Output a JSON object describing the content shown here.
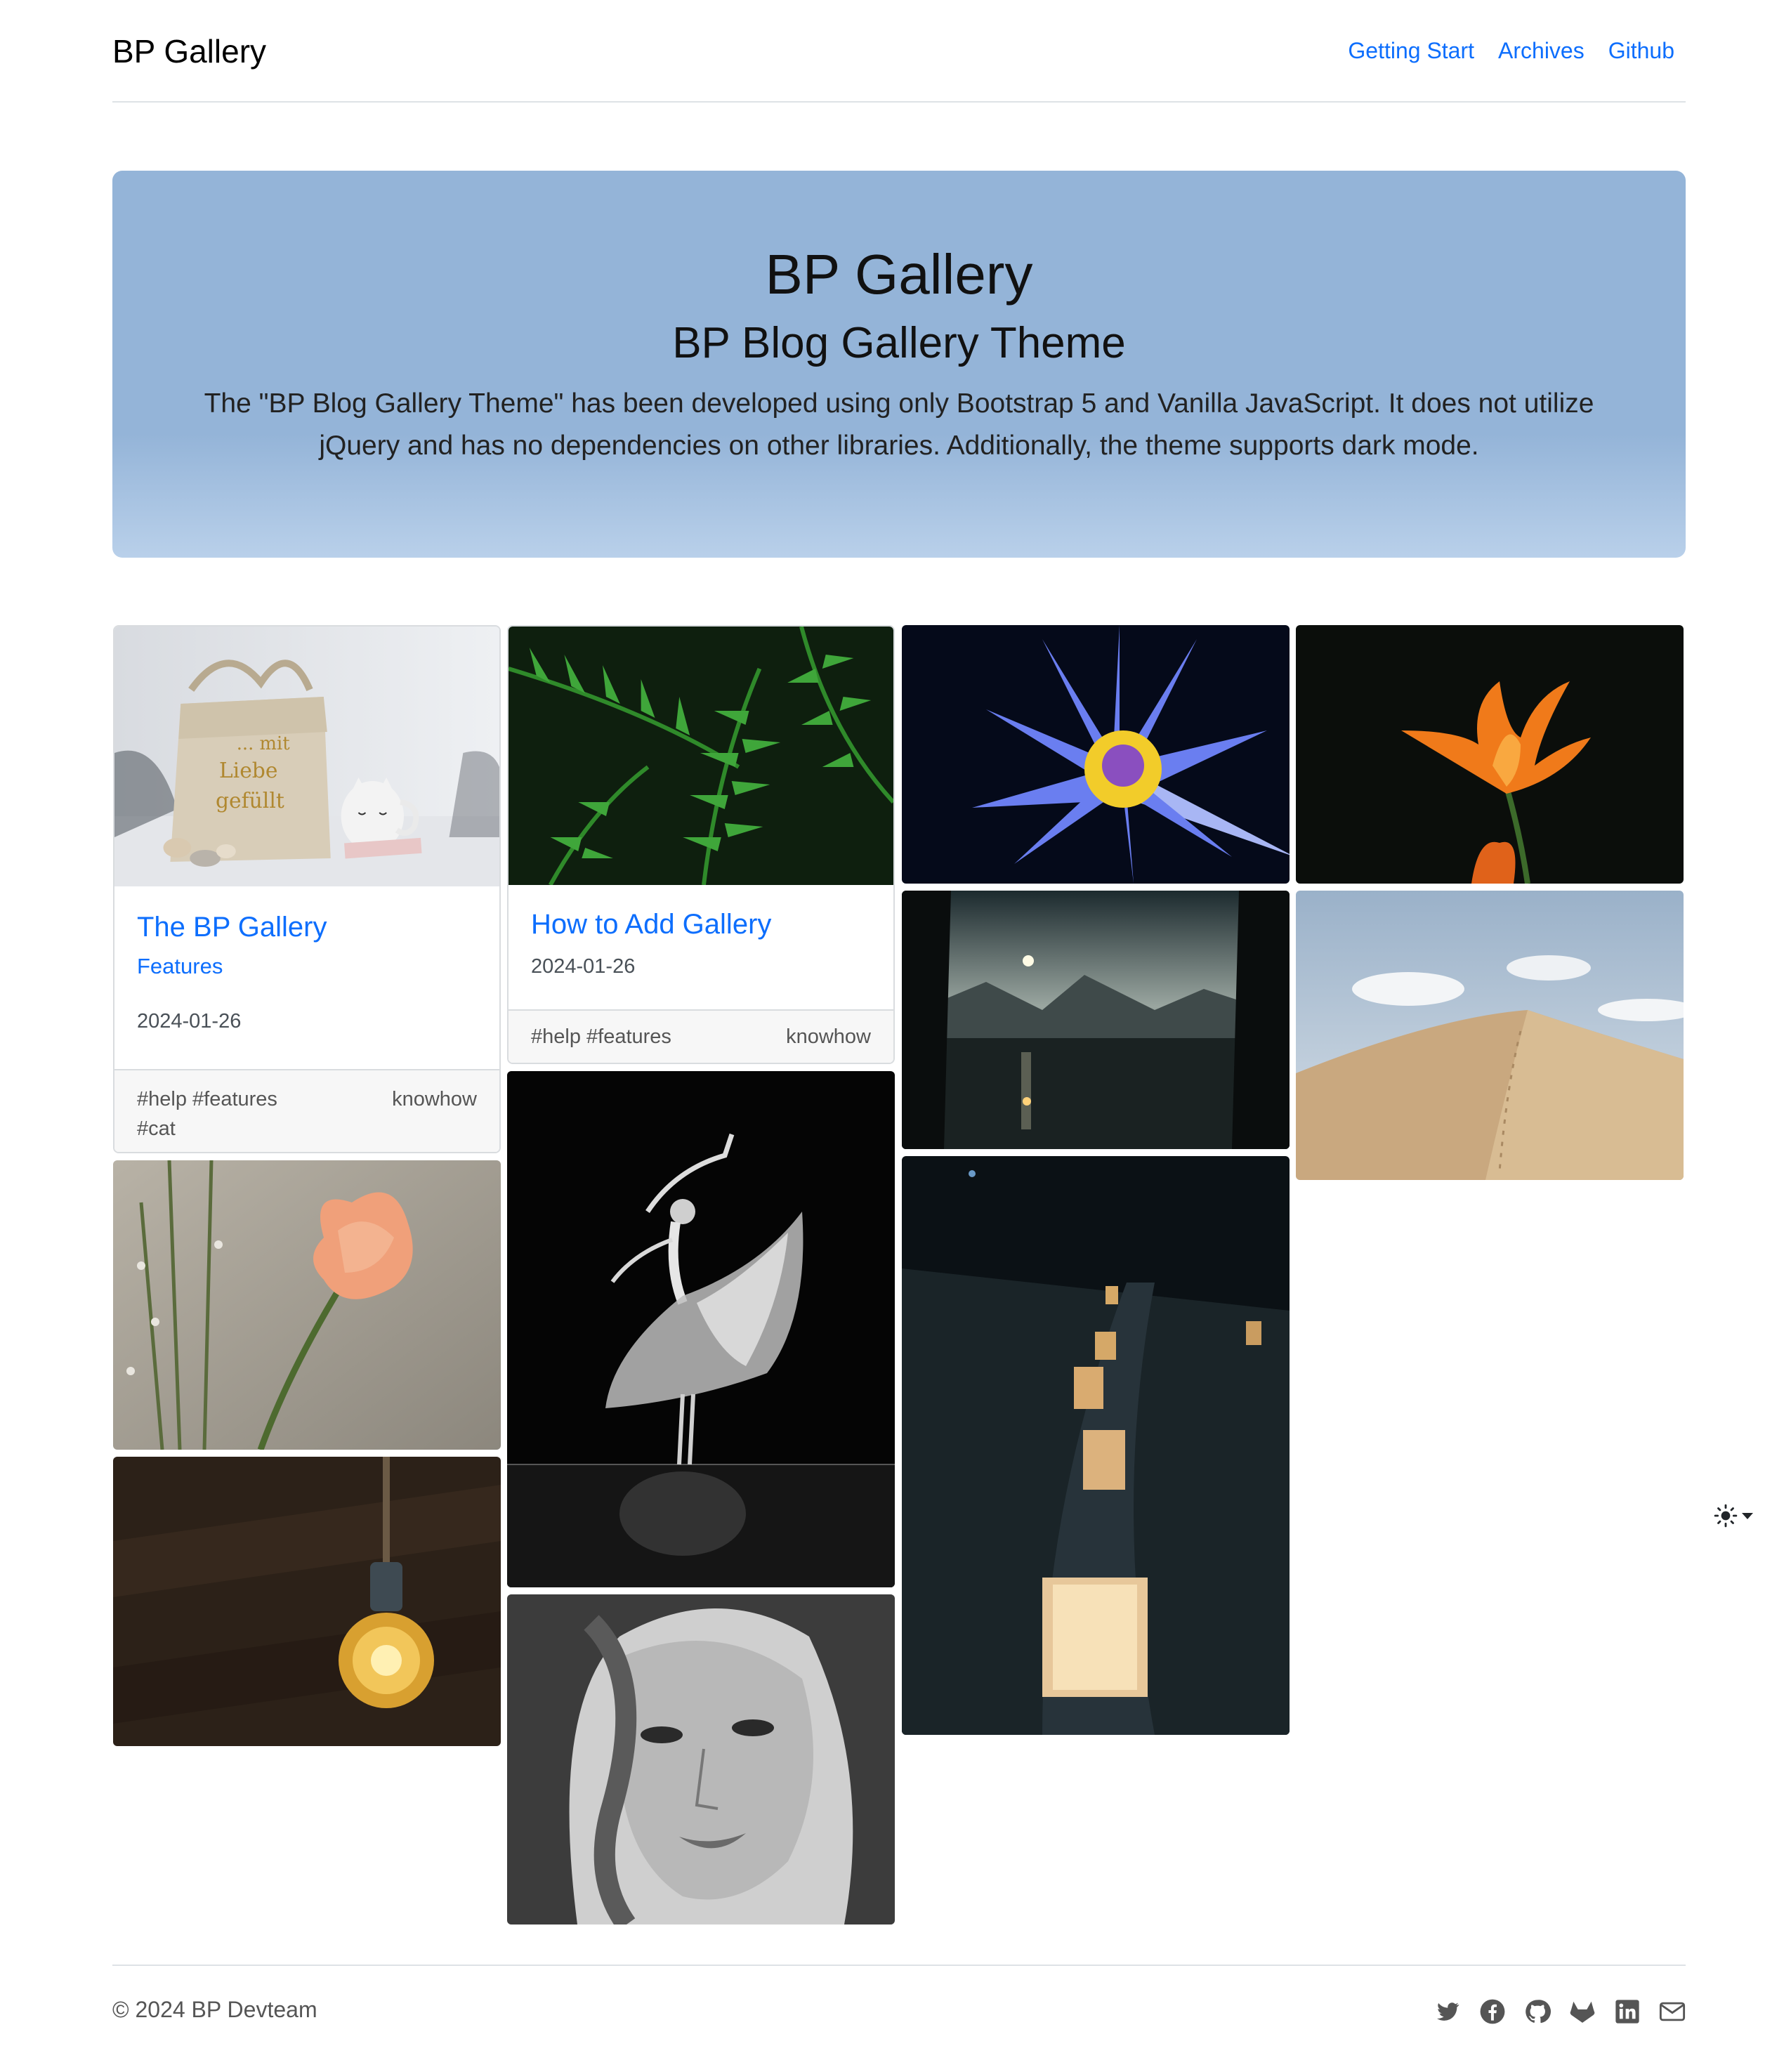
{
  "header": {
    "brand": "BP Gallery",
    "nav": [
      "Getting Start",
      "Archives",
      "Github"
    ]
  },
  "hero": {
    "title": "BP Gallery",
    "subtitle": "BP Blog Gallery Theme",
    "description": "The \"BP Blog Gallery Theme\" has been developed using only Bootstrap 5 and Vanilla JavaScript. It does not utilize jQuery and has no dependencies on other libraries. Additionally, the theme supports dark mode."
  },
  "posts": [
    {
      "title": "The BP Gallery",
      "category": "Features",
      "date": "2024-01-26",
      "tags": "#help #features #cat",
      "footer_category": "knowhow",
      "image": "canvas-bag-and-cat-mug"
    },
    {
      "title": "How to Add Gallery",
      "date": "2024-01-26",
      "tags": "#help #features",
      "footer_category": "knowhow",
      "image": "green-fern-leaves"
    }
  ],
  "photos": [
    "peach-poppy-flower",
    "glowing-edison-bulb",
    "ballet-dancer-black-and-white",
    "woman-portrait-black-and-white",
    "blue-water-lily",
    "mountain-lake-at-night",
    "paper-lanterns-in-snow",
    "orange-tulip-on-black",
    "sand-dune-with-footprints"
  ],
  "theme_toggle": {
    "icon": "sun-icon",
    "caret": "caret-down-icon"
  },
  "footer": {
    "copyright": "© 2024 BP Devteam",
    "social": [
      "twitter-icon",
      "facebook-icon",
      "github-icon",
      "gitlab-icon",
      "linkedin-icon",
      "envelope-icon"
    ]
  },
  "colors": {
    "link": "#0d6efd",
    "hero_background": "#94b4d8",
    "border": "#dee2e6",
    "card_footer": "#f7f7f7"
  }
}
